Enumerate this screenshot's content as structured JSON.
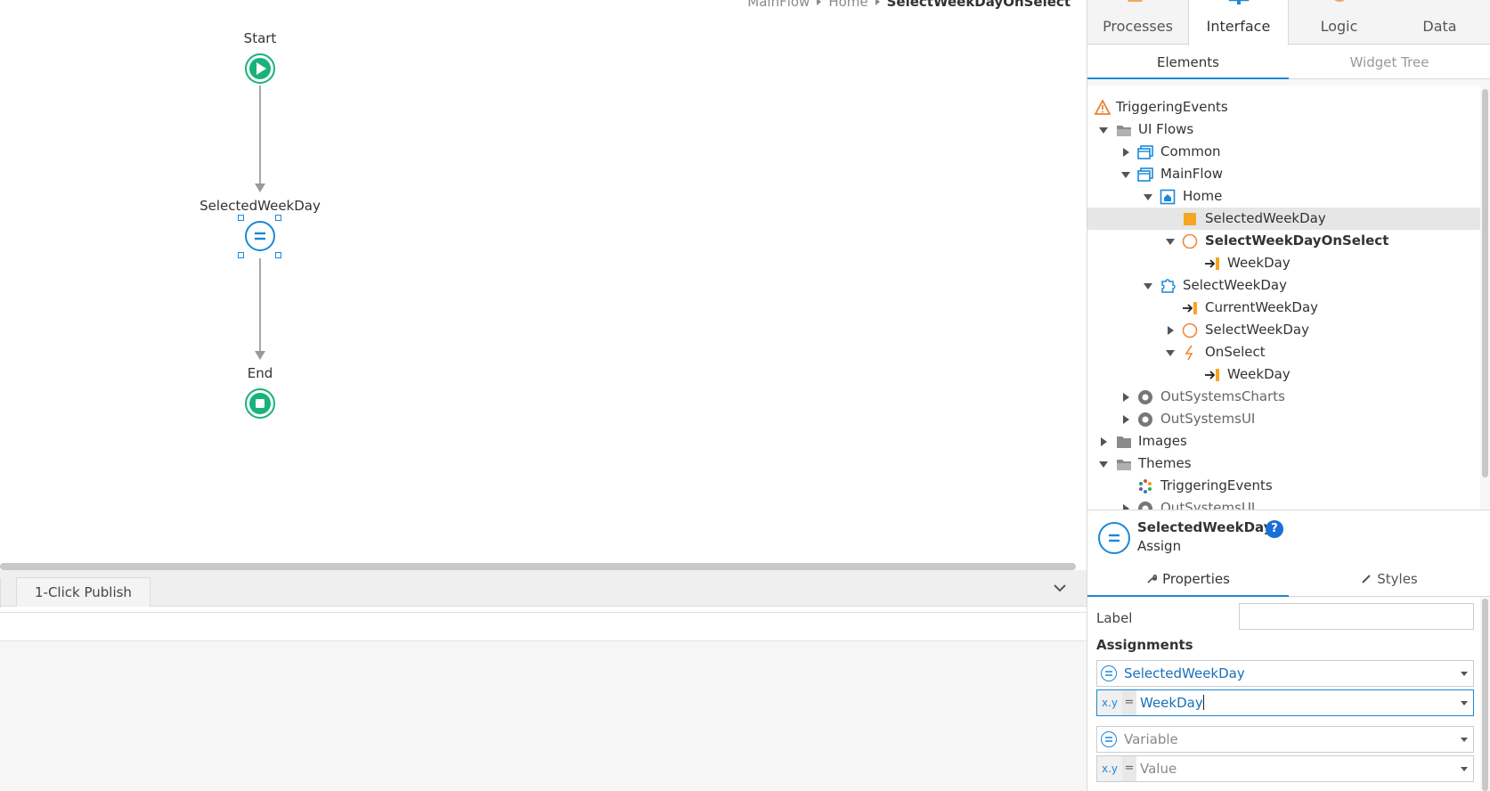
{
  "canvas": {
    "breadcrumb": {
      "items": [
        "MainFlow",
        "Home"
      ],
      "current": "SelectWeekDayOnSelect"
    },
    "nodes": {
      "start_label": "Start",
      "assign_label": "SelectedWeekDay",
      "end_label": "End"
    }
  },
  "bottom": {
    "tab_publish": "1-Click Publish"
  },
  "panel": {
    "top_tabs": [
      "Processes",
      "Interface",
      "Logic",
      "Data"
    ],
    "subtabs": [
      "Elements",
      "Widget Tree"
    ],
    "tree": [
      {
        "label": "TriggeringEvents",
        "icon": "warning-icon"
      },
      {
        "label": "UI Flows",
        "icon": "folder-open-icon"
      },
      {
        "label": "Common",
        "icon": "ui-flow-icon"
      },
      {
        "label": "MainFlow",
        "icon": "ui-flow-icon"
      },
      {
        "label": "Home",
        "icon": "screen-home-icon"
      },
      {
        "label": "SelectedWeekDay",
        "icon": "local-variable-icon"
      },
      {
        "label": "SelectWeekDayOnSelect",
        "icon": "client-action-icon"
      },
      {
        "label": "WeekDay",
        "icon": "input-parameter-icon"
      },
      {
        "label": "SelectWeekDay",
        "icon": "block-icon"
      },
      {
        "label": "CurrentWeekDay",
        "icon": "input-parameter-icon"
      },
      {
        "label": "SelectWeekDay",
        "icon": "client-action-icon"
      },
      {
        "label": "OnSelect",
        "icon": "event-icon"
      },
      {
        "label": "WeekDay",
        "icon": "input-parameter-icon"
      },
      {
        "label": "OutSystemsCharts",
        "icon": "module-icon"
      },
      {
        "label": "OutSystemsUI",
        "icon": "module-icon"
      },
      {
        "label": "Images",
        "icon": "folder-icon"
      },
      {
        "label": "Themes",
        "icon": "folder-open-icon"
      },
      {
        "label": "TriggeringEvents",
        "icon": "theme-icon"
      },
      {
        "label": "OutSystemsUI",
        "icon": "module-icon"
      }
    ],
    "selected": {
      "title": "SelectedWeekDay",
      "type": "Assign",
      "help": "?"
    },
    "prop_tabs": [
      "Properties",
      "Styles"
    ],
    "properties": {
      "label_text": "Label",
      "label_value": "",
      "assignments_heading": "Assignments",
      "assignment1_variable": "SelectedWeekDay",
      "assignment1_value": "WeekDay",
      "assignment2_variable_placeholder": "Variable",
      "assignment2_value_placeholder": "Value",
      "xy_badge": "x.y",
      "eq_sign": "="
    }
  },
  "colors": {
    "accent": "#1a88d8",
    "start_end": "#16b37a",
    "orange": "#f39c12"
  }
}
